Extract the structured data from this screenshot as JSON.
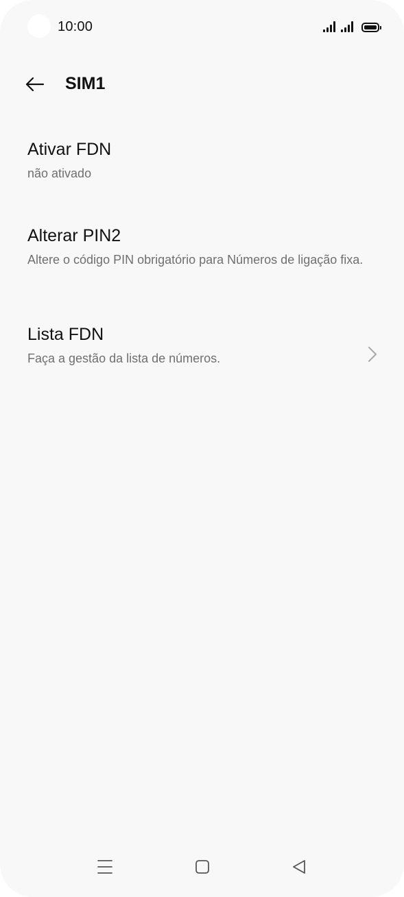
{
  "status_bar": {
    "time": "10:00",
    "icons": [
      "signal-sim1-icon",
      "signal-sim2-icon",
      "battery-icon"
    ]
  },
  "app_bar": {
    "back_icon": "arrow-left-icon",
    "title": "SIM1"
  },
  "settings": [
    {
      "title": "Ativar FDN",
      "subtitle": "não ativado"
    },
    {
      "title": "Alterar PIN2",
      "subtitle": "Altere o código PIN obrigatório para Números de ligação fixa."
    },
    {
      "title": "Lista FDN",
      "subtitle": "Faça a gestão da lista de números.",
      "trailing_icon": "chevron-right-icon"
    }
  ],
  "nav_bar": {
    "icons": [
      "menu-icon",
      "home-icon",
      "back-triangle-icon"
    ]
  },
  "colors": {
    "background": "#f8f8f8",
    "primary_text": "#111111",
    "secondary_text": "#6f6f6f"
  }
}
